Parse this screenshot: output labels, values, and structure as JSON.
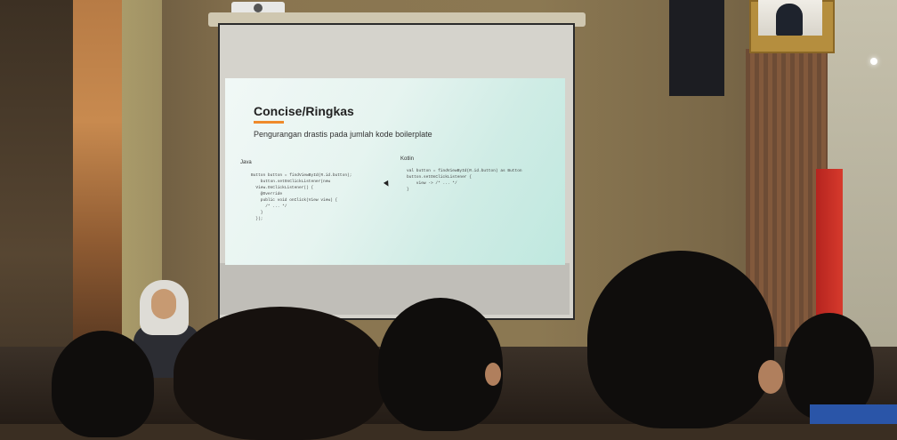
{
  "slide": {
    "title": "Concise/Ringkas",
    "subtitle": "Pengurangan drastis pada jumlah kode boilerplate",
    "java_label": "Java",
    "kotlin_label": "Kotlin",
    "java_code": "Button button = findViewById(R.id.button);\n    button.setOnClickListener(new\n  View.OnClickListener() {\n    @Override\n    public void onClick(View view) {\n      /* ... */\n    }\n  });",
    "kotlin_code": "val button = findViewById(R.id.button) as Button\nbutton.setOnClickListener {\n    view -> /* ... */\n}",
    "accent_color": "#ef8a2b"
  },
  "scene": {
    "icons": [
      "projector-icon",
      "flag-icon",
      "portrait-icon",
      "speaker-icon"
    ]
  }
}
